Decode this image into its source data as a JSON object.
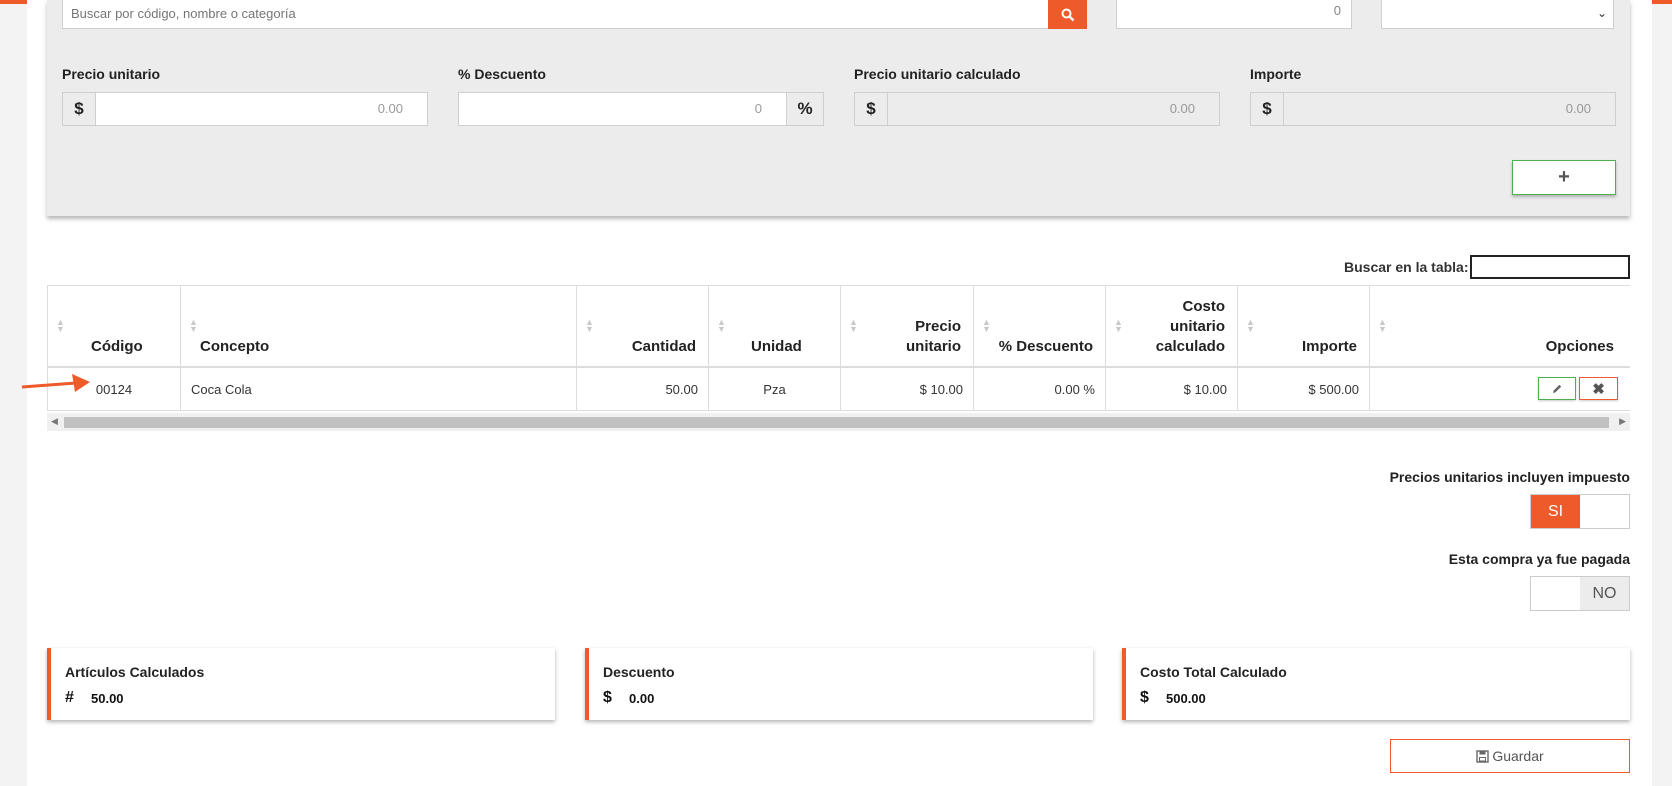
{
  "product_search": {
    "placeholder": "Buscar por código, nombre o categoría",
    "quantity_value": "0"
  },
  "fields": {
    "unit_price": {
      "label": "Precio unitario",
      "prefix": "$",
      "value": "0.00"
    },
    "discount": {
      "label": "% Descuento",
      "suffix": "%",
      "value": "0"
    },
    "calc_price": {
      "label": "Precio unitario calculado",
      "prefix": "$",
      "value": "0.00"
    },
    "amount": {
      "label": "Importe",
      "prefix": "$",
      "value": "0.00"
    }
  },
  "add_button": {
    "label": "+"
  },
  "table_search": {
    "label": "Buscar en la tabla:"
  },
  "table": {
    "headers": {
      "code": "Código",
      "concept": "Concepto",
      "quantity": "Cantidad",
      "unit": "Unidad",
      "price_l1": "Precio",
      "price_l2": "unitario",
      "discount": "% Descuento",
      "cost_l1": "Costo",
      "cost_l2": "unitario",
      "cost_l3": "calculado",
      "amount": "Importe",
      "options": "Opciones"
    },
    "rows": [
      {
        "code": "00124",
        "concept": "Coca Cola",
        "quantity": "50.00",
        "unit": "Pza",
        "price": "$ 10.00",
        "discount": "0.00 %",
        "cost": "$ 10.00",
        "amount": "$ 500.00"
      }
    ]
  },
  "toggles": {
    "tax_included": {
      "label": "Precios unitarios incluyen impuesto",
      "state": "SI"
    },
    "paid": {
      "label": "Esta compra ya fue pagada",
      "state": "NO"
    }
  },
  "summary": {
    "items": {
      "title": "Artículos Calculados",
      "icon": "#",
      "value": "50.00"
    },
    "discount": {
      "title": "Descuento",
      "icon": "$",
      "value": "0.00"
    },
    "total": {
      "title": "Costo Total Calculado",
      "icon": "$",
      "value": "500.00"
    }
  },
  "save_button": {
    "label": "Guardar"
  },
  "colors": {
    "accent": "#ef5a2a",
    "success": "#4caf50"
  }
}
